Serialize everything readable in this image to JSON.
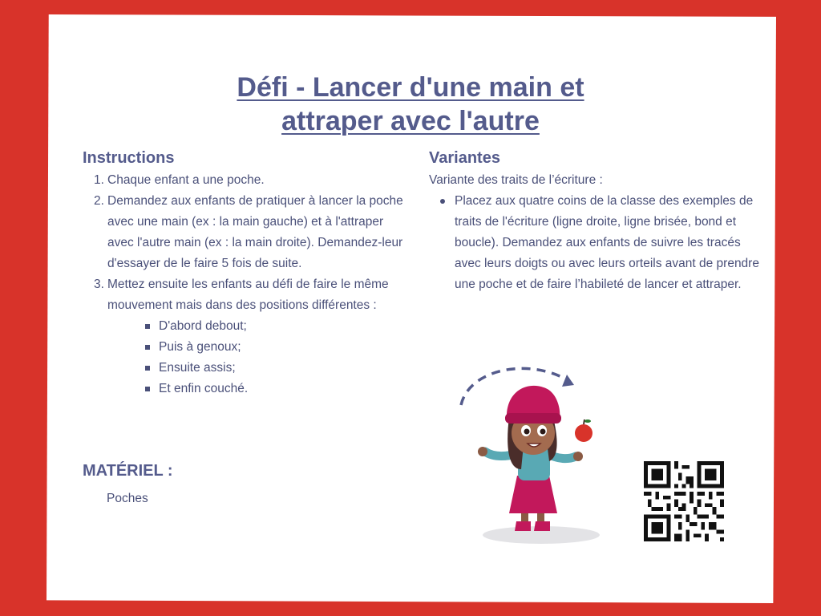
{
  "title": {
    "line1": "Défi - Lancer d'une main et",
    "line2": "attraper avec l'autre"
  },
  "instructions": {
    "heading": "Instructions",
    "steps": [
      {
        "num": "1.",
        "text": "Chaque enfant a une poche."
      },
      {
        "num": "2.",
        "text": "Demandez aux enfants de pratiquer à lancer la poche avec une main (ex : la main gauche) et à l'attraper avec l'autre main (ex : la main droite). Demandez-leur d'essayer de le faire 5 fois de suite."
      },
      {
        "num": "3.",
        "text": "Mettez ensuite les enfants au défi de faire le même mouvement mais dans des positions différentes :"
      }
    ],
    "positions": [
      "D'abord debout;",
      "Puis à genoux;",
      "Ensuite assis;",
      "Et enfin couché."
    ]
  },
  "variantes": {
    "heading": "Variantes",
    "intro": "Variante des traits de l’écriture :",
    "items": [
      "Placez aux quatre coins de la classe des exemples de traits de l'écriture (ligne droite, ligne brisée, bond et boucle). Demandez aux enfants de suivre les tracés avec leurs doigts ou avec leurs orteils avant de prendre une poche et de faire l’habileté de lancer et attraper."
    ]
  },
  "materiel": {
    "heading": "MATÉRIEL :",
    "value": "Poches"
  },
  "colors": {
    "background": "#d8332a",
    "card": "#ffffff",
    "heading": "#545b8c",
    "text": "#4a5079"
  }
}
